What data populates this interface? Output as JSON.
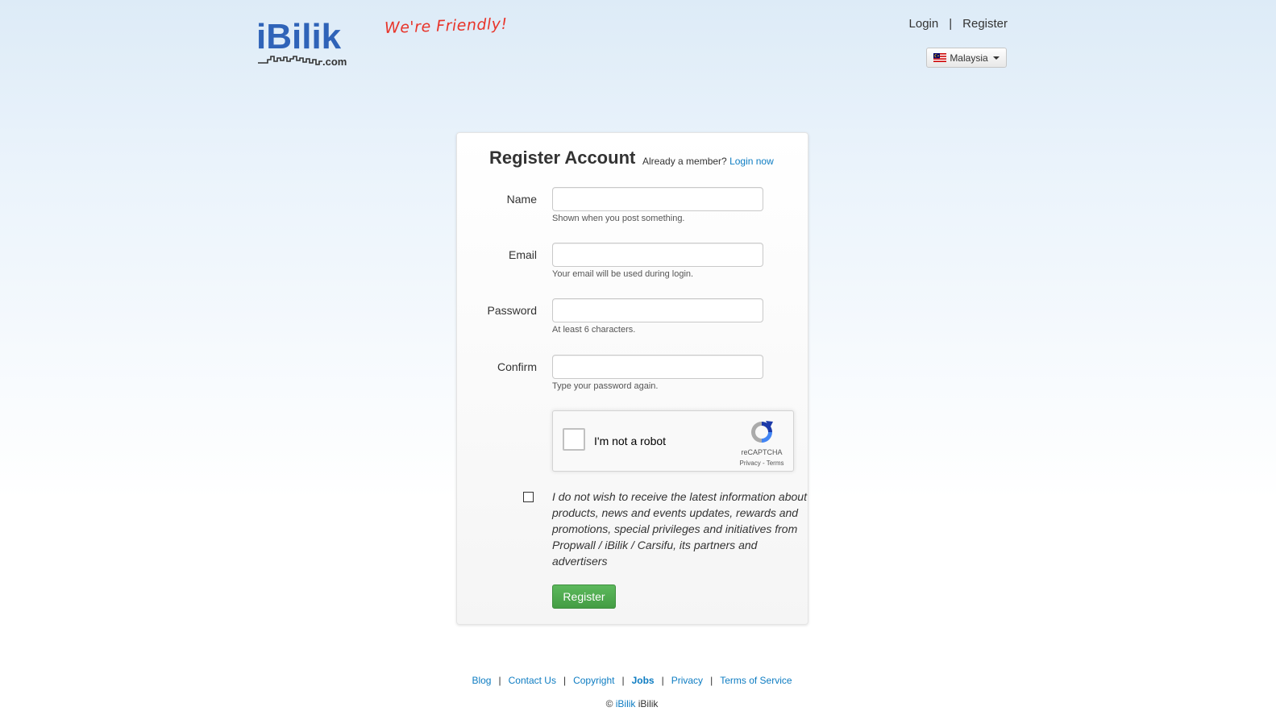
{
  "header": {
    "logo": {
      "main": "iBilik",
      "sub": ".com"
    },
    "tagline": "We're Friendly!",
    "nav": {
      "login": "Login",
      "separator": "|",
      "register": "Register"
    },
    "country": {
      "label": "Malaysia",
      "icon": "malaysia-flag-icon"
    }
  },
  "form": {
    "title": "Register Account",
    "already_member": "Already a member?",
    "login_now": "Login now",
    "fields": [
      {
        "label": "Name",
        "value": "",
        "help": "Shown when you post something."
      },
      {
        "label": "Email",
        "value": "",
        "help": "Your email will be used during login."
      },
      {
        "label": "Password",
        "value": "",
        "help": "At least 6 characters."
      },
      {
        "label": "Confirm",
        "value": "",
        "help": "Type your password again."
      }
    ],
    "recaptcha": {
      "label": "I'm not a robot",
      "brand": "reCAPTCHA",
      "privacy": "Privacy",
      "dash": " - ",
      "terms": "Terms",
      "checked": false
    },
    "optout": {
      "checked": false,
      "text": "I do not wish to receive the latest information about products, news and events updates, rewards and promotions, special privileges and initiatives from Propwall / iBilik / Carsifu, its partners and advertisers"
    },
    "submit_label": "Register"
  },
  "footer": {
    "links": [
      "Blog",
      "Contact Us",
      "Copyright",
      "Jobs",
      "Privacy",
      "Terms of Service"
    ],
    "separator": "|",
    "copyright": {
      "symbol": "©",
      "link": "iBilik",
      "text": "iBilik"
    }
  },
  "colors": {
    "accent_blue": "#0d7cc2",
    "logo_blue": "#2f63b8",
    "tagline_red": "#e8352b",
    "button_green": "#5cb85c"
  }
}
